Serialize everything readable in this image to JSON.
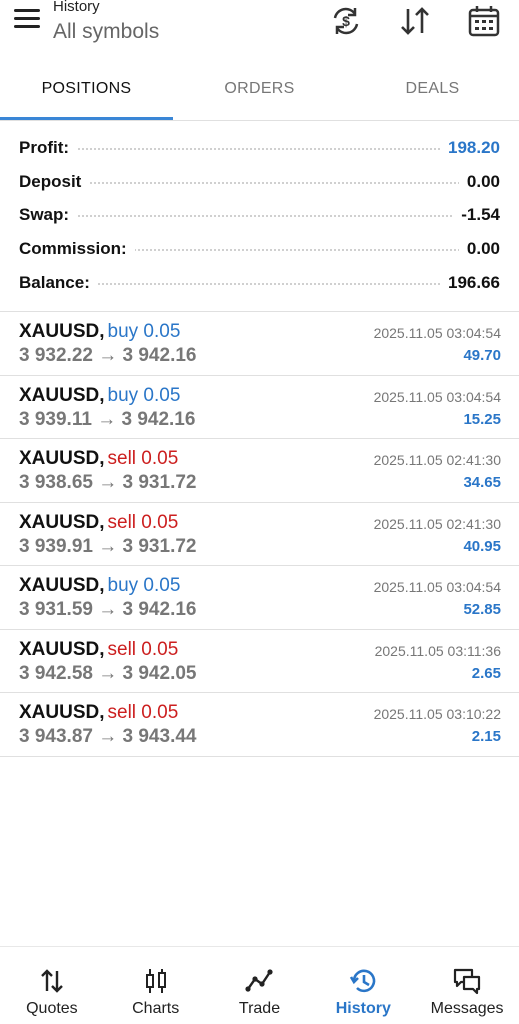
{
  "header": {
    "subtitle": "History",
    "title": "All symbols"
  },
  "tabs": [
    {
      "label": "POSITIONS",
      "active": true
    },
    {
      "label": "ORDERS",
      "active": false
    },
    {
      "label": "DEALS",
      "active": false
    }
  ],
  "summary": [
    {
      "label": "Profit:",
      "value": "198.20"
    },
    {
      "label": "Deposit",
      "value": "0.00"
    },
    {
      "label": "Swap:",
      "value": "-1.54"
    },
    {
      "label": "Commission:",
      "value": "0.00"
    },
    {
      "label": "Balance:",
      "value": "196.66"
    }
  ],
  "trades": [
    {
      "symbol": "XAUUSD",
      "type": "buy 0.05",
      "side": "buy",
      "prices": "3 932.22 → 3 942.16",
      "time": "2025.11.05 03:04:54",
      "profit": "49.70"
    },
    {
      "symbol": "XAUUSD",
      "type": "buy 0.05",
      "side": "buy",
      "prices": "3 939.11 → 3 942.16",
      "time": "2025.11.05 03:04:54",
      "profit": "15.25"
    },
    {
      "symbol": "XAUUSD",
      "type": "sell 0.05",
      "side": "sell",
      "prices": "3 938.65 → 3 931.72",
      "time": "2025.11.05 02:41:30",
      "profit": "34.65"
    },
    {
      "symbol": "XAUUSD",
      "type": "sell 0.05",
      "side": "sell",
      "prices": "3 939.91 → 3 931.72",
      "time": "2025.11.05 02:41:30",
      "profit": "40.95"
    },
    {
      "symbol": "XAUUSD",
      "type": "buy 0.05",
      "side": "buy",
      "prices": "3 931.59 → 3 942.16",
      "time": "2025.11.05 03:04:54",
      "profit": "52.85"
    },
    {
      "symbol": "XAUUSD",
      "type": "sell 0.05",
      "side": "sell",
      "prices": "3 942.58 → 3 942.05",
      "time": "2025.11.05 03:11:36",
      "profit": "2.65"
    },
    {
      "symbol": "XAUUSD",
      "type": "sell 0.05",
      "side": "sell",
      "prices": "3 943.87 → 3 943.44",
      "time": "2025.11.05 03:10:22",
      "profit": "2.15"
    }
  ],
  "nav": [
    {
      "label": "Quotes",
      "icon": "quotes-icon"
    },
    {
      "label": "Charts",
      "icon": "charts-icon"
    },
    {
      "label": "Trade",
      "icon": "trade-icon"
    },
    {
      "label": "History",
      "icon": "history-icon",
      "active": true
    },
    {
      "label": "Messages",
      "icon": "messages-icon"
    }
  ],
  "colors": {
    "accent": "#2a76c8",
    "sell": "#cc1f1f",
    "buy": "#2a76c8"
  }
}
